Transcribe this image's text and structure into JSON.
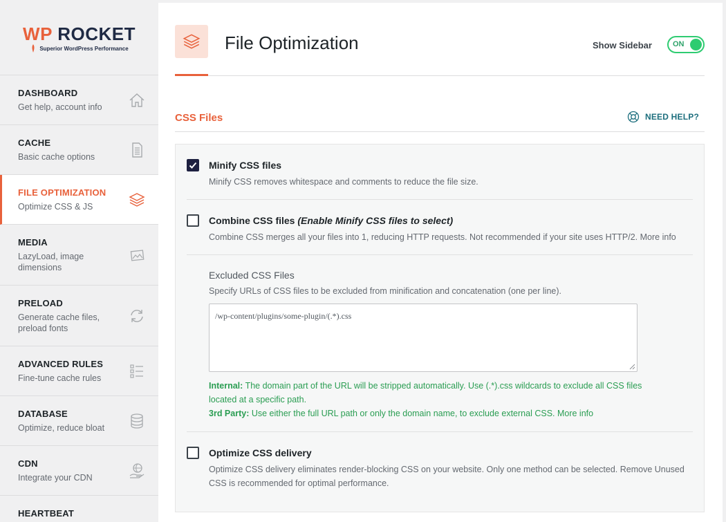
{
  "brand": {
    "wp": "WP",
    "rocket": "ROCKET",
    "tagline": "Superior WordPress Performance"
  },
  "sidebar": {
    "items": [
      {
        "title": "DASHBOARD",
        "desc": "Get help, account info",
        "icon": "home-icon"
      },
      {
        "title": "CACHE",
        "desc": "Basic cache options",
        "icon": "document-icon"
      },
      {
        "title": "FILE OPTIMIZATION",
        "desc": "Optimize CSS & JS",
        "icon": "layers-icon",
        "active": true
      },
      {
        "title": "MEDIA",
        "desc": "LazyLoad, image dimensions",
        "icon": "images-icon"
      },
      {
        "title": "PRELOAD",
        "desc": "Generate cache files, preload fonts",
        "icon": "refresh-icon"
      },
      {
        "title": "ADVANCED RULES",
        "desc": "Fine-tune cache rules",
        "icon": "list-icon"
      },
      {
        "title": "DATABASE",
        "desc": "Optimize, reduce bloat",
        "icon": "database-icon"
      },
      {
        "title": "CDN",
        "desc": "Integrate your CDN",
        "icon": "globe-hand-icon"
      },
      {
        "title": "HEARTBEAT",
        "desc": "",
        "icon": "heart-icon"
      }
    ]
  },
  "header": {
    "title": "File Optimization",
    "show_sidebar_label": "Show Sidebar",
    "toggle_state": "ON"
  },
  "section": {
    "title": "CSS Files",
    "help_label": "NEED HELP?"
  },
  "options": {
    "minify": {
      "title": "Minify CSS files",
      "desc": "Minify CSS removes whitespace and comments to reduce the file size.",
      "checked": true
    },
    "combine": {
      "title": "Combine CSS files",
      "title_note": "(Enable Minify CSS files to select)",
      "desc": "Combine CSS merges all your files into 1, reducing HTTP requests. Not recommended if your site uses HTTP/2. More info",
      "checked": false
    },
    "excluded": {
      "label": "Excluded CSS Files",
      "desc": "Specify URLs of CSS files to be excluded from minification and concatenation (one per line).",
      "value": "/wp-content/plugins/some-plugin/(.*).css",
      "internal_label": "Internal:",
      "internal_text": "The domain part of the URL will be stripped automatically. Use (.*).css wildcards to exclude all CSS files located at a specific path.",
      "third_label": "3rd Party:",
      "third_text": "Use either the full URL path or only the domain name, to exclude external CSS. More info"
    },
    "delivery": {
      "title": "Optimize CSS delivery",
      "desc": "Optimize CSS delivery eliminates render-blocking CSS on your website. Only one method can be selected. Remove Unused CSS is recommended for optimal performance.",
      "checked": false
    }
  },
  "colors": {
    "accent": "#e8613b",
    "toggle_on": "#2ecc71",
    "note_green": "#2a9d52",
    "help_teal": "#1c6e7d"
  }
}
